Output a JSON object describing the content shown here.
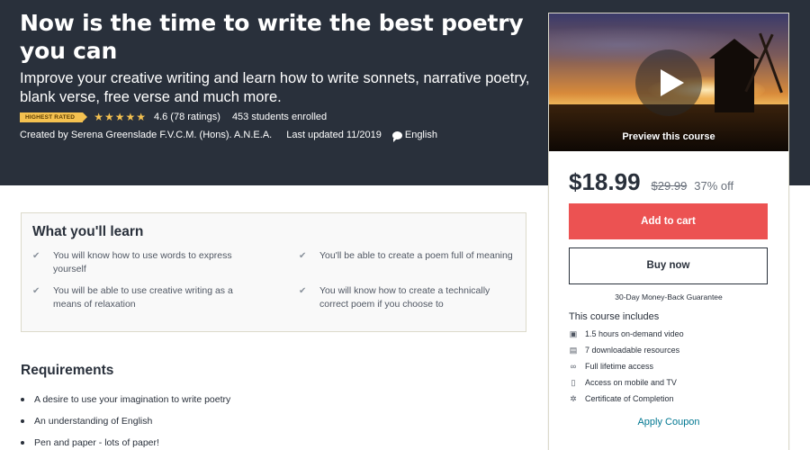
{
  "hero": {
    "title": "Now is the time to write the best poetry you can",
    "subtitle": "Improve your creative writing and learn how to write sonnets, narrative poetry, blank verse, free verse and much more.",
    "badge": "HIGHEST RATED",
    "rating": "4.6",
    "rating_count": "(78 ratings)",
    "students": "453 students enrolled",
    "stars": "★★★★★",
    "stars_value": 4.6,
    "created_by": "Created by Serena Greenslade F.V.C.M. (Hons). A.N.E.A.",
    "last_updated": "Last updated 11/2019",
    "language": "English"
  },
  "sidebar": {
    "preview_label": "Preview this course",
    "price": "$18.99",
    "old_price": "$29.99",
    "discount": "37% off",
    "add_to_cart": "Add to cart",
    "buy_now": "Buy now",
    "guarantee": "30-Day Money-Back Guarantee",
    "includes_title": "This course includes",
    "includes": [
      {
        "icon": "video-icon",
        "text": "1.5 hours on-demand video"
      },
      {
        "icon": "file-icon",
        "text": "7 downloadable resources"
      },
      {
        "icon": "infinity-icon",
        "text": "Full lifetime access"
      },
      {
        "icon": "mobile-icon",
        "text": "Access on mobile and TV"
      },
      {
        "icon": "certificate-icon",
        "text": "Certificate of Completion"
      }
    ],
    "apply_coupon": "Apply Coupon"
  },
  "learn": {
    "title": "What you'll learn",
    "items": [
      "You will know how to use words to express yourself",
      "You'll be able to create a poem full of meaning",
      "You will be able to use creative writing as a means of relaxation",
      "You will know how to create a technically correct poem if you choose to"
    ]
  },
  "requirements": {
    "title": "Requirements",
    "items": [
      "A desire to use your imagination to write poetry",
      "An understanding of English",
      "Pen and paper - lots of paper!"
    ]
  },
  "colors": {
    "hero_bg": "#29303b",
    "accent_red": "#ec5252",
    "star_gold": "#f4c150",
    "link_teal": "#007791"
  }
}
